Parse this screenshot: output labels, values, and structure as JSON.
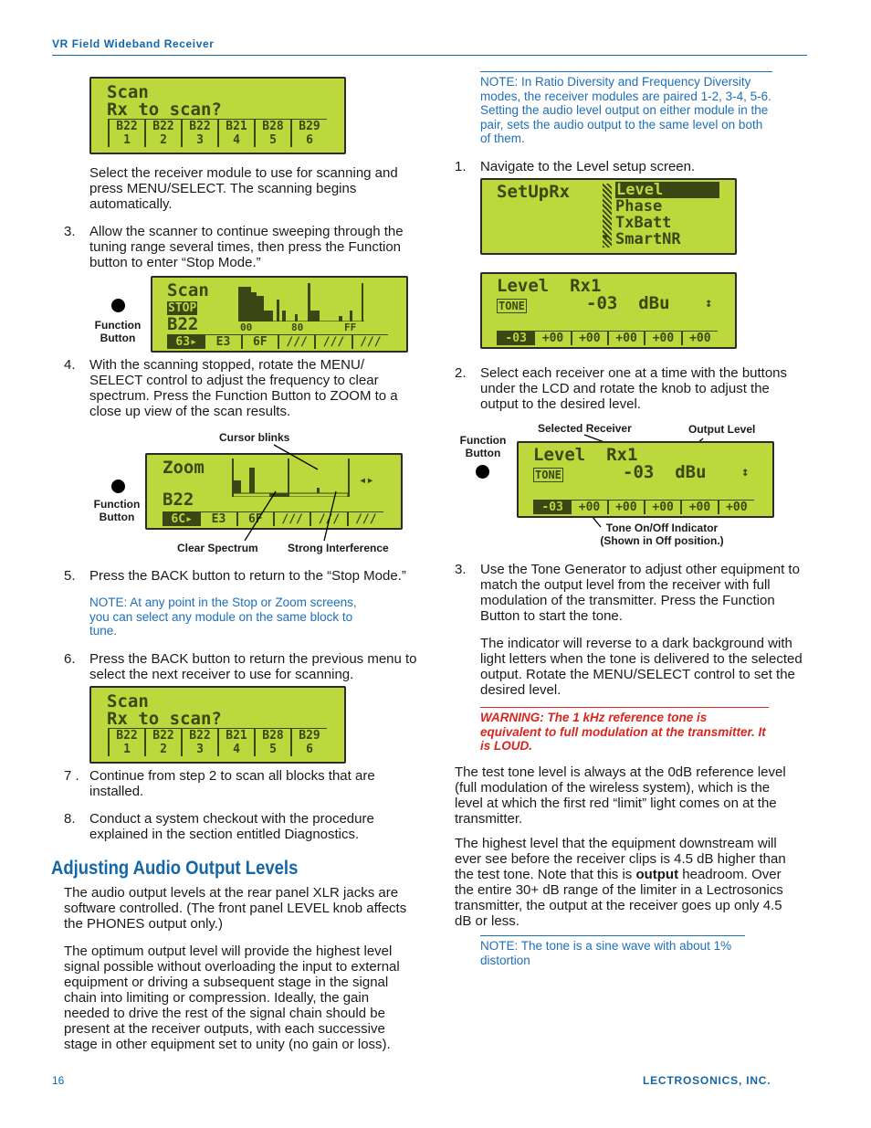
{
  "header": {
    "title": "VR Field Wideband Receiver"
  },
  "left": {
    "lcd_scan": {
      "line1": "Scan",
      "line2": "Rx to scan?",
      "cells_top": [
        "B22",
        "B22",
        "B22",
        "B21",
        "B28",
        "B29"
      ],
      "cells_bottom": [
        "1",
        "2",
        "3",
        "4",
        "5",
        "6"
      ]
    },
    "para_select": "Select the receiver module to use for scanning and press MENU/SELECT. The scanning begins automatically.",
    "step3": {
      "num": "3.",
      "text": "Allow the scanner to continue sweeping through the tuning range several times, then press the Function button to enter “Stop Mode.”"
    },
    "function_button_label": "Function Button",
    "lcd_stop": {
      "line1": "Scan",
      "stop": "STOP",
      "block": "B22",
      "axis": [
        "00",
        "80",
        "FF"
      ],
      "cells": [
        "63▸",
        "E3",
        "6F",
        "∕∕∕",
        "∕∕∕",
        "∕∕∕"
      ]
    },
    "step4": {
      "num": "4.",
      "text": "With the scanning stopped, rotate the MENU/ SELECT control to adjust the frequency to clear spectrum. Press the Function Button to ZOOM to a close up view of the scan results."
    },
    "callouts_zoom": {
      "cursor": "Cursor blinks",
      "clear": "Clear Spectrum",
      "strong": "Strong Interference"
    },
    "lcd_zoom": {
      "line1": "Zoom",
      "block": "B22",
      "arrows": "◂▸",
      "cells": [
        "6C▸",
        "E3",
        "6F",
        "∕∕∕",
        "∕∕∕",
        "∕∕∕"
      ]
    },
    "step5": {
      "num": "5.",
      "text": "Press the BACK button to return to the “Stop Mode.”"
    },
    "note1": "NOTE:  At any point in the Stop or Zoom screens, you can select any module on the same block to tune.",
    "step6": {
      "num": "6.",
      "text": "Press the BACK button to return the previous menu to select the next receiver to use for scanning."
    },
    "step7": {
      "num": "7 .",
      "text": "Continue from step 2 to scan all blocks that are installed."
    },
    "step8": {
      "num": "8.",
      "text": "Conduct a system checkout with the procedure explained in the section entitled Diagnostics."
    },
    "heading": "Adjusting Audio Output Levels",
    "para_a": "The audio output levels at the rear panel XLR jacks are software controlled. (The front panel LEVEL knob affects the PHONES output only.)",
    "para_b": "The optimum output level will provide the highest level signal possible without overloading the input to external equipment or driving a subsequent stage in the signal chain into limiting or compression. Ideally, the gain needed to drive the rest of the signal chain should be present at the receiver outputs, with each successive stage in other equipment set to unity (no gain or loss)."
  },
  "right": {
    "note_top": "NOTE:  In Ratio Diversity and Frequency Diversity modes, the receiver modules are paired 1-2, 3-4, 5-6. Setting the audio level output on either module in the pair, sets the audio output to the same level on both of them.",
    "step1": {
      "num": "1.",
      "text": "Navigate to the Level setup screen."
    },
    "lcd_setup": {
      "title": "SetUpRx",
      "items": [
        "Level",
        "Phase",
        "TxBatt",
        "SmartNR"
      ],
      "arrow": "▼"
    },
    "lcd_level": {
      "line1": "Level  Rx1",
      "tone": "TONE",
      "value": "-03  dBu",
      "updown": "↕",
      "cells": [
        "-03",
        "+00",
        "+00",
        "+00",
        "+00",
        "+00"
      ]
    },
    "step2": {
      "num": "2.",
      "text": "Select each receiver one at a time with the buttons under the LCD and rotate the knob to adjust the output to the desired level."
    },
    "callouts_level": {
      "function": "Function Button",
      "selected": "Selected Receiver",
      "output": "Output Level",
      "tone1": "Tone On/Off Indicator",
      "tone2": "(Shown in Off position.)"
    },
    "step3": {
      "num": "3.",
      "text": "Use the Tone Generator to adjust other equipment to match the output level from the receiver with full modulation of the transmitter. Press the Function Button to start the tone."
    },
    "para_indicator": "The indicator will reverse to a dark background with light letters when the tone is delivered to the selected output. Rotate the MENU/SELECT control to set the desired level.",
    "warning": "WARNING:  The 1 kHz reference tone is equivalent to full modulation at the transmitter. It is LOUD.",
    "para_test": "The test tone level is always at the 0dB reference level (full modulation of the wireless system), which is the level at which the first red “limit” light comes on at the transmitter.",
    "para_high_1": "The highest level that the equipment downstream will ever see before the receiver clips is 4.5 dB higher than the test tone. Note that this is ",
    "para_high_bold": "output",
    "para_high_2": " headroom. Over the entire 30+ dB range of the limiter in a Lectrosonics transmitter, the output at the receiver goes up only 4.5 dB or less.",
    "note_bottom": "NOTE:  The tone is a sine wave with about 1% distortion"
  },
  "footer": {
    "page": "16",
    "company": "LECTROSONICS, INC."
  },
  "colors": {
    "brand": "#1366a8",
    "note": "#1f6fb8",
    "warning": "#d6261f",
    "lcd": "#bcd83c"
  }
}
